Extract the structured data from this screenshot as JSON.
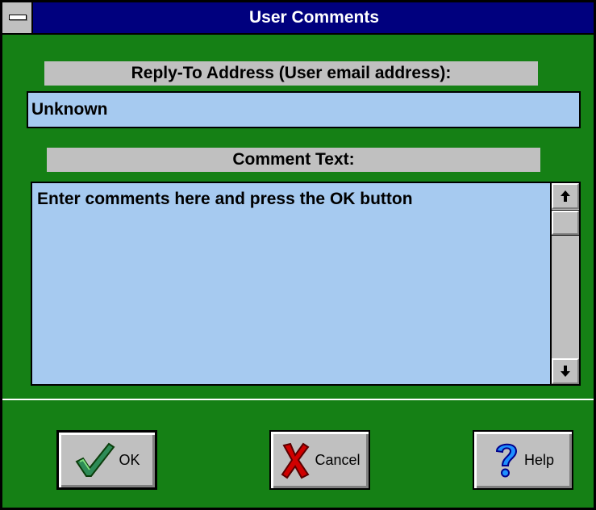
{
  "window": {
    "title": "User Comments",
    "system_menu_icon": "system-menu-icon"
  },
  "reply_to": {
    "label": "Reply-To Address (User email address):",
    "value": "Unknown"
  },
  "comment": {
    "label": "Comment Text:",
    "value": "Enter comments here and press the OK button"
  },
  "buttons": {
    "ok": {
      "label": "OK",
      "icon": "checkmark-icon"
    },
    "cancel": {
      "label": "Cancel",
      "icon": "x-mark-icon"
    },
    "help": {
      "label": "Help",
      "icon": "question-mark-icon"
    }
  },
  "colors": {
    "background": "#158015",
    "titlebar": "#00007e",
    "field": "#a6caf0",
    "label": "#c0c0c0",
    "ok_icon": "#2e8b57",
    "cancel_icon": "#d00000",
    "help_icon": "#1e90ff"
  }
}
